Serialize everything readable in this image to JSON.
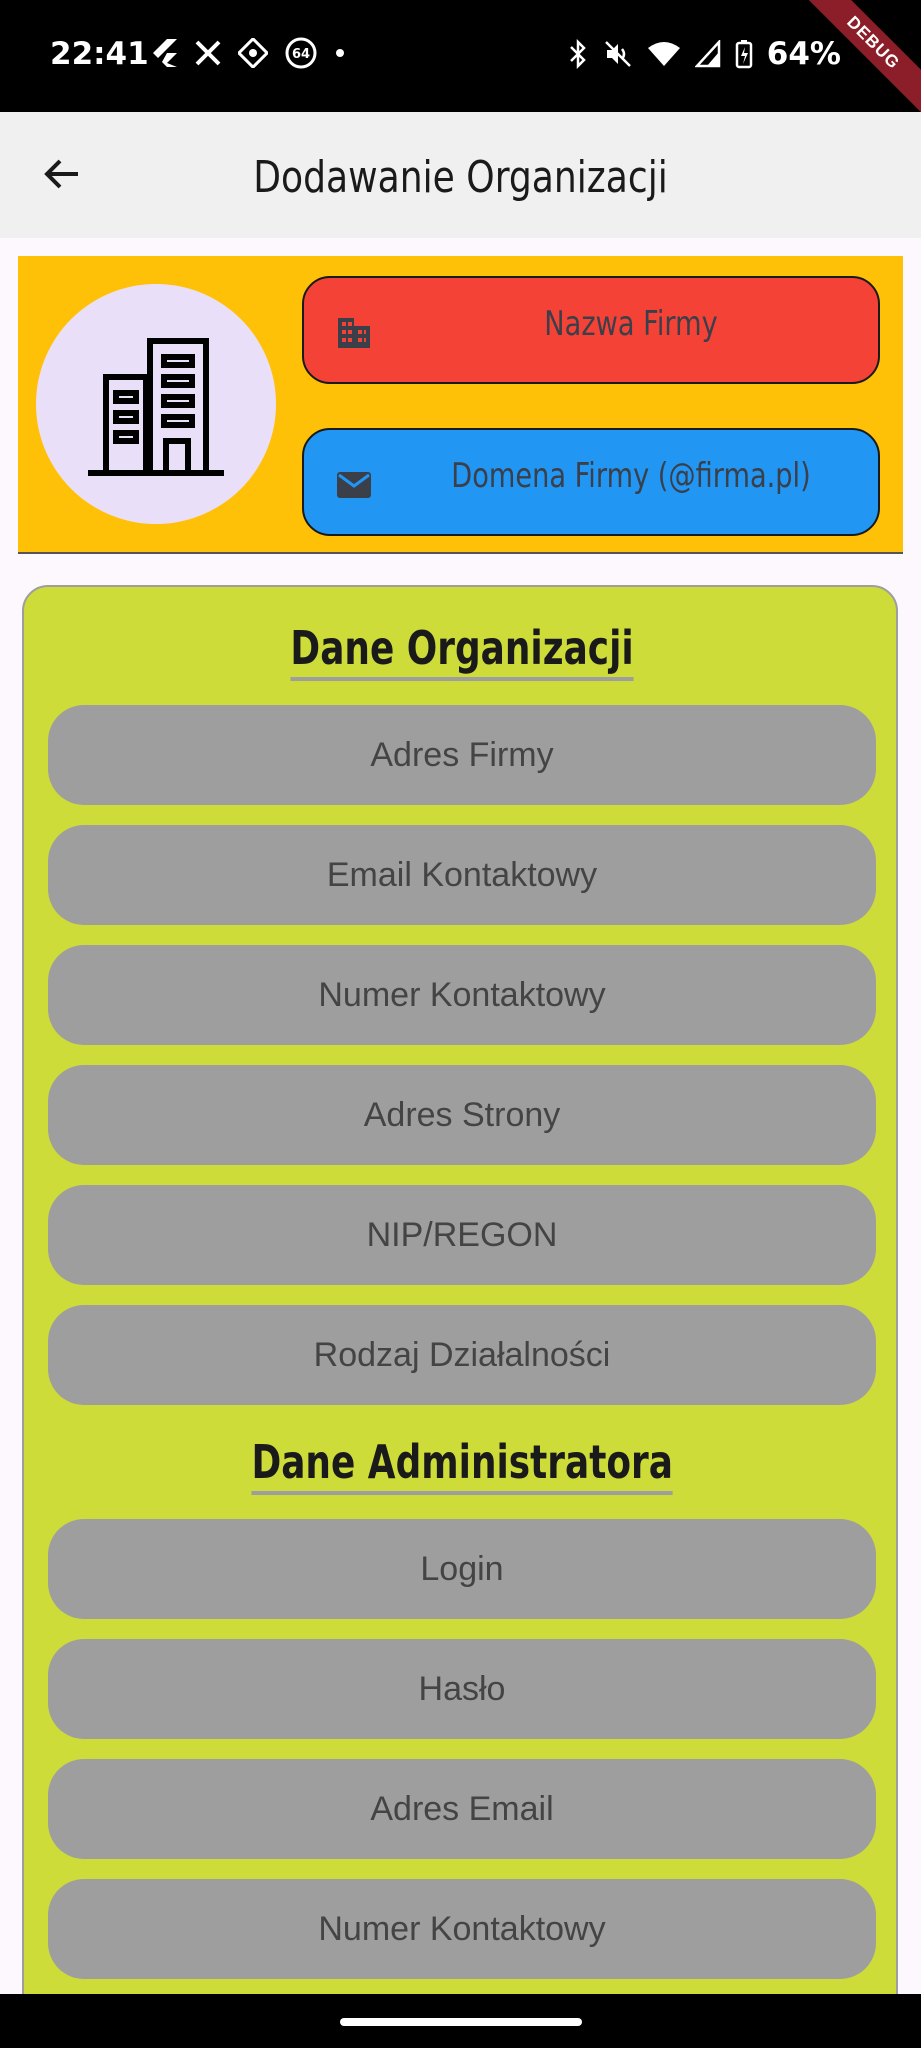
{
  "status_bar": {
    "time": "22:41",
    "left_icons": [
      "flutter-icon",
      "x-icon",
      "app-icon",
      "notification-64-icon",
      "dot-icon"
    ],
    "notification_badge": "64",
    "battery_percent": "64%",
    "debug_label": "DEBUG"
  },
  "app_bar": {
    "title": "Dodawanie Organizacji",
    "back_icon": "arrow-back-icon"
  },
  "header": {
    "logo_icon": "building-icon",
    "name_button": {
      "label": "Nazwa Firmy",
      "icon": "business-icon",
      "color": "#f44336"
    },
    "domain_button": {
      "label": "Domena Firmy (@firma.pl)",
      "icon": "email-icon",
      "color": "#2196f3"
    },
    "background": "#ffc107"
  },
  "form": {
    "background": "#cddc39",
    "org_section": {
      "title": "Dane Organizacji",
      "fields": [
        "Adres Firmy",
        "Email Kontaktowy",
        "Numer Kontaktowy",
        "Adres Strony",
        "NIP/REGON",
        "Rodzaj Działalności"
      ]
    },
    "admin_section": {
      "title": "Dane Administratora",
      "fields": [
        "Login",
        "Hasło",
        "Adres Email",
        "Numer Kontaktowy"
      ]
    }
  }
}
